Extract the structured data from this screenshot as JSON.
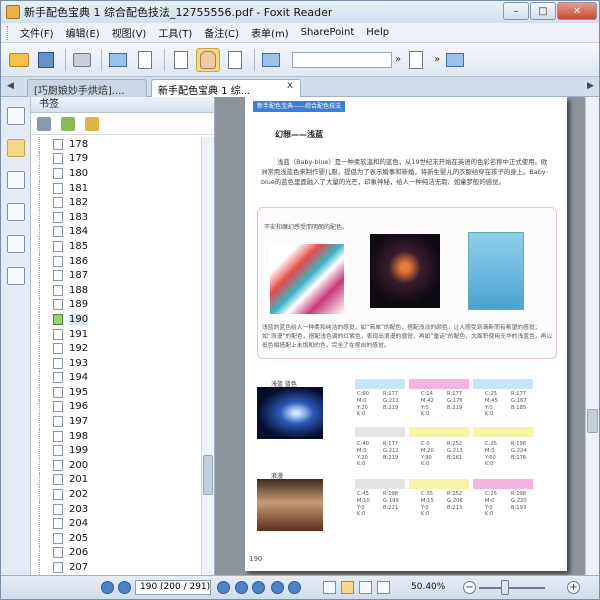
{
  "window": {
    "title": "新手配色宝典 1 综合配色技法_12755556.pdf - Foxit Reader",
    "min": "–",
    "max": "□",
    "close": "✕"
  },
  "menu": [
    "文件(F)",
    "编辑(E)",
    "视图(V)",
    "工具(T)",
    "备注(C)",
    "表单(m)",
    "SharePoint",
    "Help"
  ],
  "tabs": [
    {
      "label": "[巧厨娘妙手烘焙]....",
      "active": false
    },
    {
      "label": "新手配色宝典 1 综...",
      "active": true
    }
  ],
  "tab_close": "x",
  "panel": {
    "title": "书签",
    "bookmarks": [
      "178",
      "179",
      "180",
      "181",
      "182",
      "183",
      "184",
      "185",
      "186",
      "187",
      "188",
      "189",
      "190",
      "191",
      "192",
      "193",
      "194",
      "195",
      "196",
      "197",
      "198",
      "199",
      "200",
      "201",
      "202",
      "203",
      "204",
      "205",
      "206",
      "207"
    ],
    "current": "190"
  },
  "doc": {
    "banner": "新手配色宝典——综合配色技法",
    "heading": "幻想——浅蓝",
    "paragraph": "浅蓝（Baby-blue）是一种柔软温和的蓝色，从19世纪末开始在英语的色彩名称中正式使用。欧洲常用浅蓝色来制作婴儿服，提倡为了表示婚事和新婚，将新生婴儿的衣服给穿在孩子的身上。Baby-blue的蓝色里面融入了大量的光芒，印象神秘，给人一种纯洁无瑕、如童梦般的感觉。",
    "figure_caption": "不安和魔幻感受而明朗的配色。",
    "figure_text": "浅蓝的蓝色给人一种柔和纯洁的感觉。如“简单”的配色，搭配浅淡的颜色，让人感受到清新而有希望的感觉；如“浪漫”的配色，搭配浅色调的红紫色，表现出浪漫的感觉，再如“童话”的配色，大面积使用无华的浅蓝色，再以低色相搭配上未饱和的色，完全了在视自的感觉。",
    "swatch_label_1": "浅蓝 蓝色",
    "swatch_label_2": "浪漫",
    "cmyk": [
      [
        "C:90\nM:0\nY:20\nK:0",
        "R:177\nG:212\nB:219",
        "C:14\nM:42\nY:0\nK:0",
        "R:177\nG:176\nB:219",
        "C:25\nM:45\nY:0\nK:0",
        "R:177\nG:167\nB:185"
      ],
      [
        "C:40\nM:0\nY:20\nK:0",
        "R:177\nG:212\nB:219",
        "C:0\nM:20\nY:90\nK:0",
        "R:252\nG:213\nB:161",
        "C:25\nM:0\nY:60\nK:0",
        "R:198\nG:224\nB:176"
      ],
      [
        "C:45\nM:10\nY:0\nK:0",
        "R:198\nG:199\nB:221",
        "C:35\nM:15\nY:0\nK:0",
        "R:252\nG:206\nB:213",
        "C:25\nM:0\nY:0\nK:0",
        "R:198\nG:220\nB:193"
      ]
    ],
    "page_number": "190"
  },
  "status": {
    "page_field": "190 (200 / 291)",
    "zoom": "50.40%",
    "minus": "−",
    "plus": "+"
  }
}
